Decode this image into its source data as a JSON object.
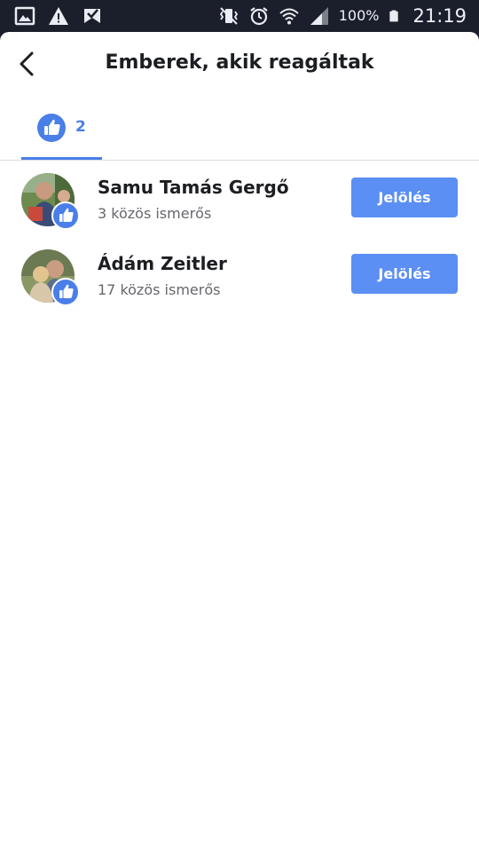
{
  "status_bar": {
    "battery": "100%",
    "time": "21:19"
  },
  "header": {
    "title": "Emberek, akik reagáltak"
  },
  "tabs": [
    {
      "icon": "like-icon",
      "count": "2"
    }
  ],
  "people": [
    {
      "name": "Samu Tamás Gergő",
      "mutual": "3 közös ismerős",
      "button_label": "Jelölés"
    },
    {
      "name": "Ádám Zeitler",
      "mutual": "17 közös ismerős",
      "button_label": "Jelölés"
    }
  ],
  "colors": {
    "accent": "#4a7ee8",
    "button": "#5b8ff3",
    "status_bar": "#1b1f2b"
  }
}
